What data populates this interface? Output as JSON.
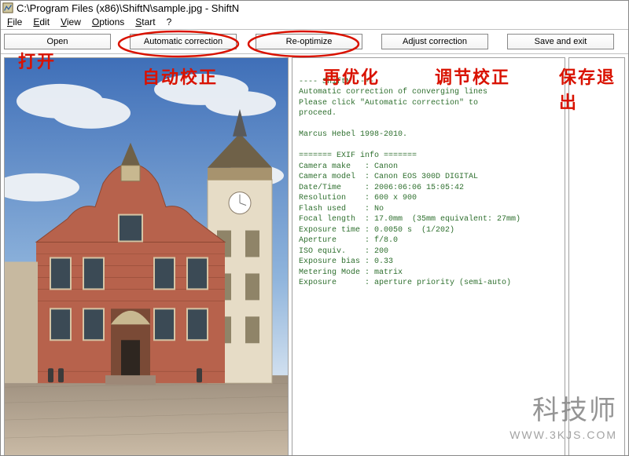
{
  "window": {
    "title": "C:\\Program Files (x86)\\ShiftN\\sample.jpg - ShiftN"
  },
  "menu": {
    "file": "File",
    "edit": "Edit",
    "view": "View",
    "options": "Options",
    "start": "Start",
    "help": "?"
  },
  "toolbar": {
    "open": "Open",
    "auto": "Automatic correction",
    "reopt": "Re-optimize",
    "adjust": "Adjust correction",
    "save": "Save and exit"
  },
  "annotations": {
    "open": "打开",
    "auto": "自动校正",
    "reopt": "再优化",
    "adjust": "调节校正",
    "save": "保存退出"
  },
  "info": {
    "banner1": "---- ShiftN ----",
    "banner2": "Automatic correction of converging lines",
    "banner3": "Please click \"Automatic correction\" to",
    "banner4": "proceed.",
    "credit": "Marcus Hebel 1998-2010.",
    "exifhdr": "======= EXIF info =======",
    "make_l": "Camera make",
    "make_v": "Canon",
    "model_l": "Camera model",
    "model_v": "Canon EOS 300D DIGITAL",
    "date_l": "Date/Time",
    "date_v": "2006:06:06 15:05:42",
    "res_l": "Resolution",
    "res_v": "600 x 900",
    "flash_l": "Flash used",
    "flash_v": "No",
    "focal_l": "Focal length",
    "focal_v": "17.0mm  (35mm equivalent: 27mm)",
    "exp_l": "Exposure time",
    "exp_v": "0.0050 s  (1/202)",
    "ap_l": "Aperture",
    "ap_v": "f/8.0",
    "iso_l": "ISO equiv.",
    "iso_v": "200",
    "bias_l": "Exposure bias",
    "bias_v": "0.33",
    "meter_l": "Metering Mode",
    "meter_v": "matrix",
    "mode_l": "Exposure",
    "mode_v": "aperture priority (semi-auto)"
  },
  "watermark": {
    "big": "科技师",
    "small": "WWW.3KJS.COM"
  },
  "colors": {
    "infoText": "#2e6f2e",
    "annoRed": "#d91200"
  }
}
